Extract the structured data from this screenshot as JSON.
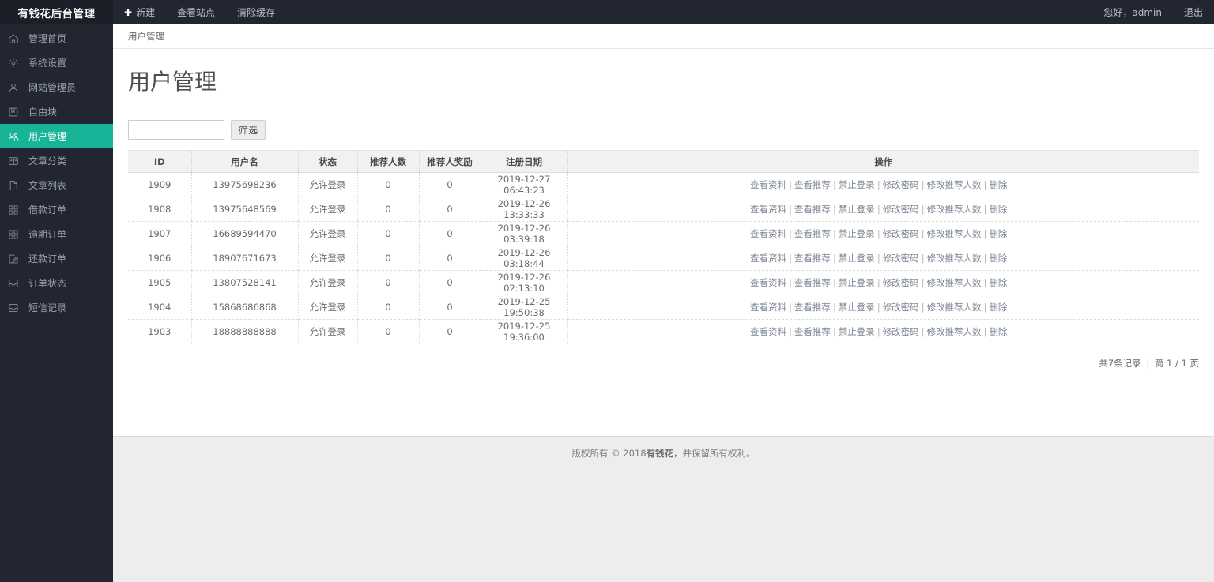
{
  "brand": {
    "logo_text": "有钱花后台管理"
  },
  "topnav": {
    "items": [
      {
        "label": "新建",
        "icon": "plus-icon",
        "has_plus": true
      },
      {
        "label": "查看站点",
        "icon": "",
        "has_plus": false
      },
      {
        "label": "清除缓存",
        "icon": "",
        "has_plus": false
      }
    ],
    "greeting": "您好，admin",
    "logout_label": "退出"
  },
  "sidebar": {
    "items": [
      {
        "label": "管理首页",
        "icon": "home-icon",
        "active": false
      },
      {
        "label": "系统设置",
        "icon": "gear-icon",
        "active": false
      },
      {
        "label": "网站管理员",
        "icon": "user-icon",
        "active": false
      },
      {
        "label": "自由块",
        "icon": "book-icon",
        "active": false
      },
      {
        "label": "用户管理",
        "icon": "users-icon",
        "active": true
      },
      {
        "label": "文章分类",
        "icon": "open-book-icon",
        "active": false
      },
      {
        "label": "文章列表",
        "icon": "file-icon",
        "active": false
      },
      {
        "label": "借款订单",
        "icon": "grid-icon",
        "active": false
      },
      {
        "label": "逾期订单",
        "icon": "grid-icon",
        "active": false
      },
      {
        "label": "还款订单",
        "icon": "edit-square-icon",
        "active": false
      },
      {
        "label": "订单状态",
        "icon": "inbox-icon",
        "active": false
      },
      {
        "label": "短信记录",
        "icon": "inbox-icon",
        "active": false
      }
    ]
  },
  "breadcrumb": {
    "text": "用户管理"
  },
  "page": {
    "title": "用户管理"
  },
  "filter": {
    "value": "",
    "placeholder": "",
    "button_label": "筛选"
  },
  "table": {
    "columns": [
      "ID",
      "用户名",
      "状态",
      "推荐人数",
      "推荐人奖励",
      "注册日期",
      "操作"
    ],
    "actions": [
      "查看资料",
      "查看推荐",
      "禁止登录",
      "修改密码",
      "修改推荐人数",
      "删除"
    ],
    "action_separator": "|",
    "rows": [
      {
        "id": "1909",
        "username": "13975698236",
        "status": "允许登录",
        "ref_count": "0",
        "ref_reward": "0",
        "reg_date": "2019-12-27 06:43:23"
      },
      {
        "id": "1908",
        "username": "13975648569",
        "status": "允许登录",
        "ref_count": "0",
        "ref_reward": "0",
        "reg_date": "2019-12-26 13:33:33"
      },
      {
        "id": "1907",
        "username": "16689594470",
        "status": "允许登录",
        "ref_count": "0",
        "ref_reward": "0",
        "reg_date": "2019-12-26 03:39:18"
      },
      {
        "id": "1906",
        "username": "18907671673",
        "status": "允许登录",
        "ref_count": "0",
        "ref_reward": "0",
        "reg_date": "2019-12-26 03:18:44"
      },
      {
        "id": "1905",
        "username": "13807528141",
        "status": "允许登录",
        "ref_count": "0",
        "ref_reward": "0",
        "reg_date": "2019-12-26 02:13:10"
      },
      {
        "id": "1904",
        "username": "15868686868",
        "status": "允许登录",
        "ref_count": "0",
        "ref_reward": "0",
        "reg_date": "2019-12-25 19:50:38"
      },
      {
        "id": "1903",
        "username": "18888888888",
        "status": "允许登录",
        "ref_count": "0",
        "ref_reward": "0",
        "reg_date": "2019-12-25 19:36:00"
      }
    ]
  },
  "pagination": {
    "total_text": "共7条记录",
    "separator": "|",
    "page_text": "第 1 / 1 页"
  },
  "footer": {
    "prefix": "版权所有 © 2018 ",
    "site_name": "有钱花",
    "suffix": "，并保留所有权利。"
  },
  "colors": {
    "sidebar_bg": "#212630",
    "logo_bg": "#1b1f27",
    "accent": "#18b497",
    "page_bg": "#ededed",
    "content_bg": "#ffffff"
  }
}
